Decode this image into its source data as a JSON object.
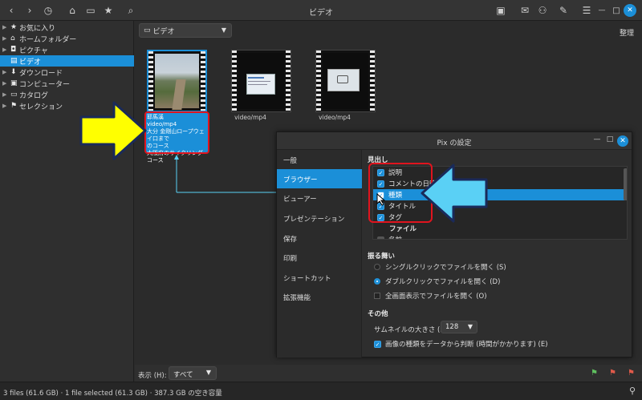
{
  "window": {
    "title": "ビデオ"
  },
  "header": {
    "back_icon": "‹",
    "forward_icon": "›",
    "history_icon": "◷",
    "home_icon": "⌂",
    "drive_icon": "▭",
    "star_icon": "★",
    "search_icon": "⌕",
    "slideshow_icon": "▣",
    "comment_icon": "✉",
    "tags_icon": "⚇",
    "tools_icon": "✎",
    "menu_icon": "☰",
    "min_icon": "—",
    "max_icon": "□",
    "close_icon": "✕"
  },
  "sidebar": {
    "items": [
      {
        "label": "お気に入り",
        "icon": "★"
      },
      {
        "label": "ホームフォルダー",
        "icon": "⌂"
      },
      {
        "label": "ピクチャ",
        "icon": "◘"
      },
      {
        "label": "ビデオ",
        "icon": "▤"
      },
      {
        "label": "ダウンロード",
        "icon": "⬇"
      },
      {
        "label": "コンピューター",
        "icon": "▣"
      },
      {
        "label": "カタログ",
        "icon": "▭"
      },
      {
        "label": "セレクション",
        "icon": "⚑"
      }
    ]
  },
  "toolbar": {
    "path": "ビデオ",
    "path_icon": "▭",
    "sort": "整理"
  },
  "thumbnails": [
    {
      "caption": ""
    },
    {
      "caption": "video/mp4"
    },
    {
      "caption": "video/mp4"
    }
  ],
  "selected_card": {
    "line1": "耶馬溪",
    "line2": "video/mp4",
    "line3": "大分 金剛山ロープウェイ口まで",
    "line4": "のコース",
    "line5": "大阪府のサイクリングコース"
  },
  "bottom": {
    "show_label": "表示 (H):",
    "show_value": "すべて"
  },
  "status": {
    "text": "3 files (61.6 GB) · 1 file selected (61.3 GB) · 387.3 GB の空き容量",
    "pin_icon": "⚲"
  },
  "dialog": {
    "title": "Pix の設定",
    "sidebar": [
      "一般",
      "ブラウザー",
      "ビューアー",
      "プレゼンテーション",
      "保存",
      "印刷",
      "ショートカット",
      "拡張機能"
    ],
    "captions_header": "見出し",
    "caption_items": [
      "説明",
      "コメントの日時",
      "種類",
      "タイトル",
      "タグ"
    ],
    "file_header": "ファイル",
    "file_partial": "名前",
    "behavior_header": "振る舞い",
    "behavior_options": [
      "シングルクリックでファイルを開く (S)",
      "ダブルクリックでファイルを開く (D)",
      "全画面表示でファイルを開く (O)"
    ],
    "other_header": "その他",
    "thumb_size_label": "サムネイルの大きさ (S):",
    "thumb_size_value": "128",
    "detect_type": "画像の種類をデータから判断 (時間がかかります) (E)"
  },
  "colors": {
    "accent": "#1b8fd8",
    "highlight_red": "#e0141e",
    "arrow_yellow": "#ffff00",
    "arrow_cyan": "#5ad0f5"
  }
}
